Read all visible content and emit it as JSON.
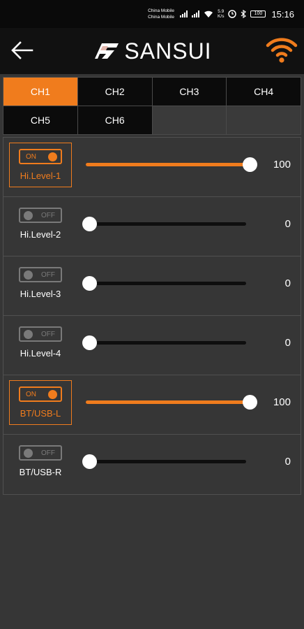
{
  "status_bar": {
    "carrier_1": "China Mobile",
    "carrier_2": "China Mobile",
    "speed_value": "5.9",
    "speed_unit": "K/s",
    "battery": "100",
    "time": "15:16"
  },
  "header": {
    "brand": "SANSUI",
    "accent_color": "#f07c1d"
  },
  "tabs": [
    {
      "label": "CH1",
      "active": true
    },
    {
      "label": "CH2",
      "active": false
    },
    {
      "label": "CH3",
      "active": false
    },
    {
      "label": "CH4",
      "active": false
    },
    {
      "label": "CH5",
      "active": false
    },
    {
      "label": "CH6",
      "active": false
    }
  ],
  "channels": [
    {
      "label": "Hi.Level-1",
      "state": "ON",
      "on": true,
      "value": "100",
      "level": 100
    },
    {
      "label": "Hi.Level-2",
      "state": "OFF",
      "on": false,
      "value": "0",
      "level": 0
    },
    {
      "label": "Hi.Level-3",
      "state": "OFF",
      "on": false,
      "value": "0",
      "level": 0
    },
    {
      "label": "Hi.Level-4",
      "state": "OFF",
      "on": false,
      "value": "0",
      "level": 0
    },
    {
      "label": "BT/USB-L",
      "state": "ON",
      "on": true,
      "value": "100",
      "level": 100
    },
    {
      "label": "BT/USB-R",
      "state": "OFF",
      "on": false,
      "value": "0",
      "level": 0
    }
  ]
}
